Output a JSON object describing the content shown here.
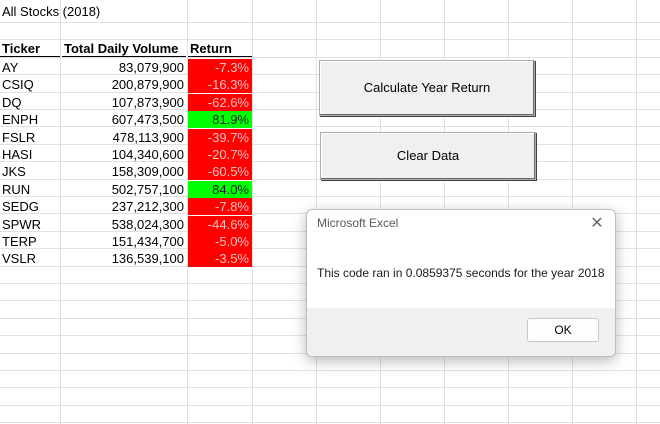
{
  "sheet": {
    "title": "All Stocks (2018)",
    "headers": {
      "ticker": "Ticker",
      "volume": "Total Daily Volume",
      "return": "Return"
    },
    "rows": [
      {
        "ticker": "AY",
        "volume": "83,079,900",
        "return": "-7.3%",
        "positive": false
      },
      {
        "ticker": "CSIQ",
        "volume": "200,879,900",
        "return": "-16.3%",
        "positive": false
      },
      {
        "ticker": "DQ",
        "volume": "107,873,900",
        "return": "-62.6%",
        "positive": false
      },
      {
        "ticker": "ENPH",
        "volume": "607,473,500",
        "return": "81.9%",
        "positive": true
      },
      {
        "ticker": "FSLR",
        "volume": "478,113,900",
        "return": "-39.7%",
        "positive": false
      },
      {
        "ticker": "HASI",
        "volume": "104,340,600",
        "return": "-20.7%",
        "positive": false
      },
      {
        "ticker": "JKS",
        "volume": "158,309,000",
        "return": "-60.5%",
        "positive": false
      },
      {
        "ticker": "RUN",
        "volume": "502,757,100",
        "return": "84.0%",
        "positive": true
      },
      {
        "ticker": "SEDG",
        "volume": "237,212,300",
        "return": "-7.8%",
        "positive": false
      },
      {
        "ticker": "SPWR",
        "volume": "538,024,300",
        "return": "-44.6%",
        "positive": false
      },
      {
        "ticker": "TERP",
        "volume": "151,434,700",
        "return": "-5.0%",
        "positive": false
      },
      {
        "ticker": "VSLR",
        "volume": "136,539,100",
        "return": "-3.5%",
        "positive": false
      }
    ]
  },
  "buttons": {
    "calculate": "Calculate Year Return",
    "clear": "Clear Data"
  },
  "dialog": {
    "title": "Microsoft Excel",
    "message": "This code ran in 0.0859375 seconds for the year 2018",
    "ok": "OK",
    "close_icon": "close-icon"
  },
  "colors": {
    "negative": "#ff0000",
    "positive": "#00ff00"
  }
}
